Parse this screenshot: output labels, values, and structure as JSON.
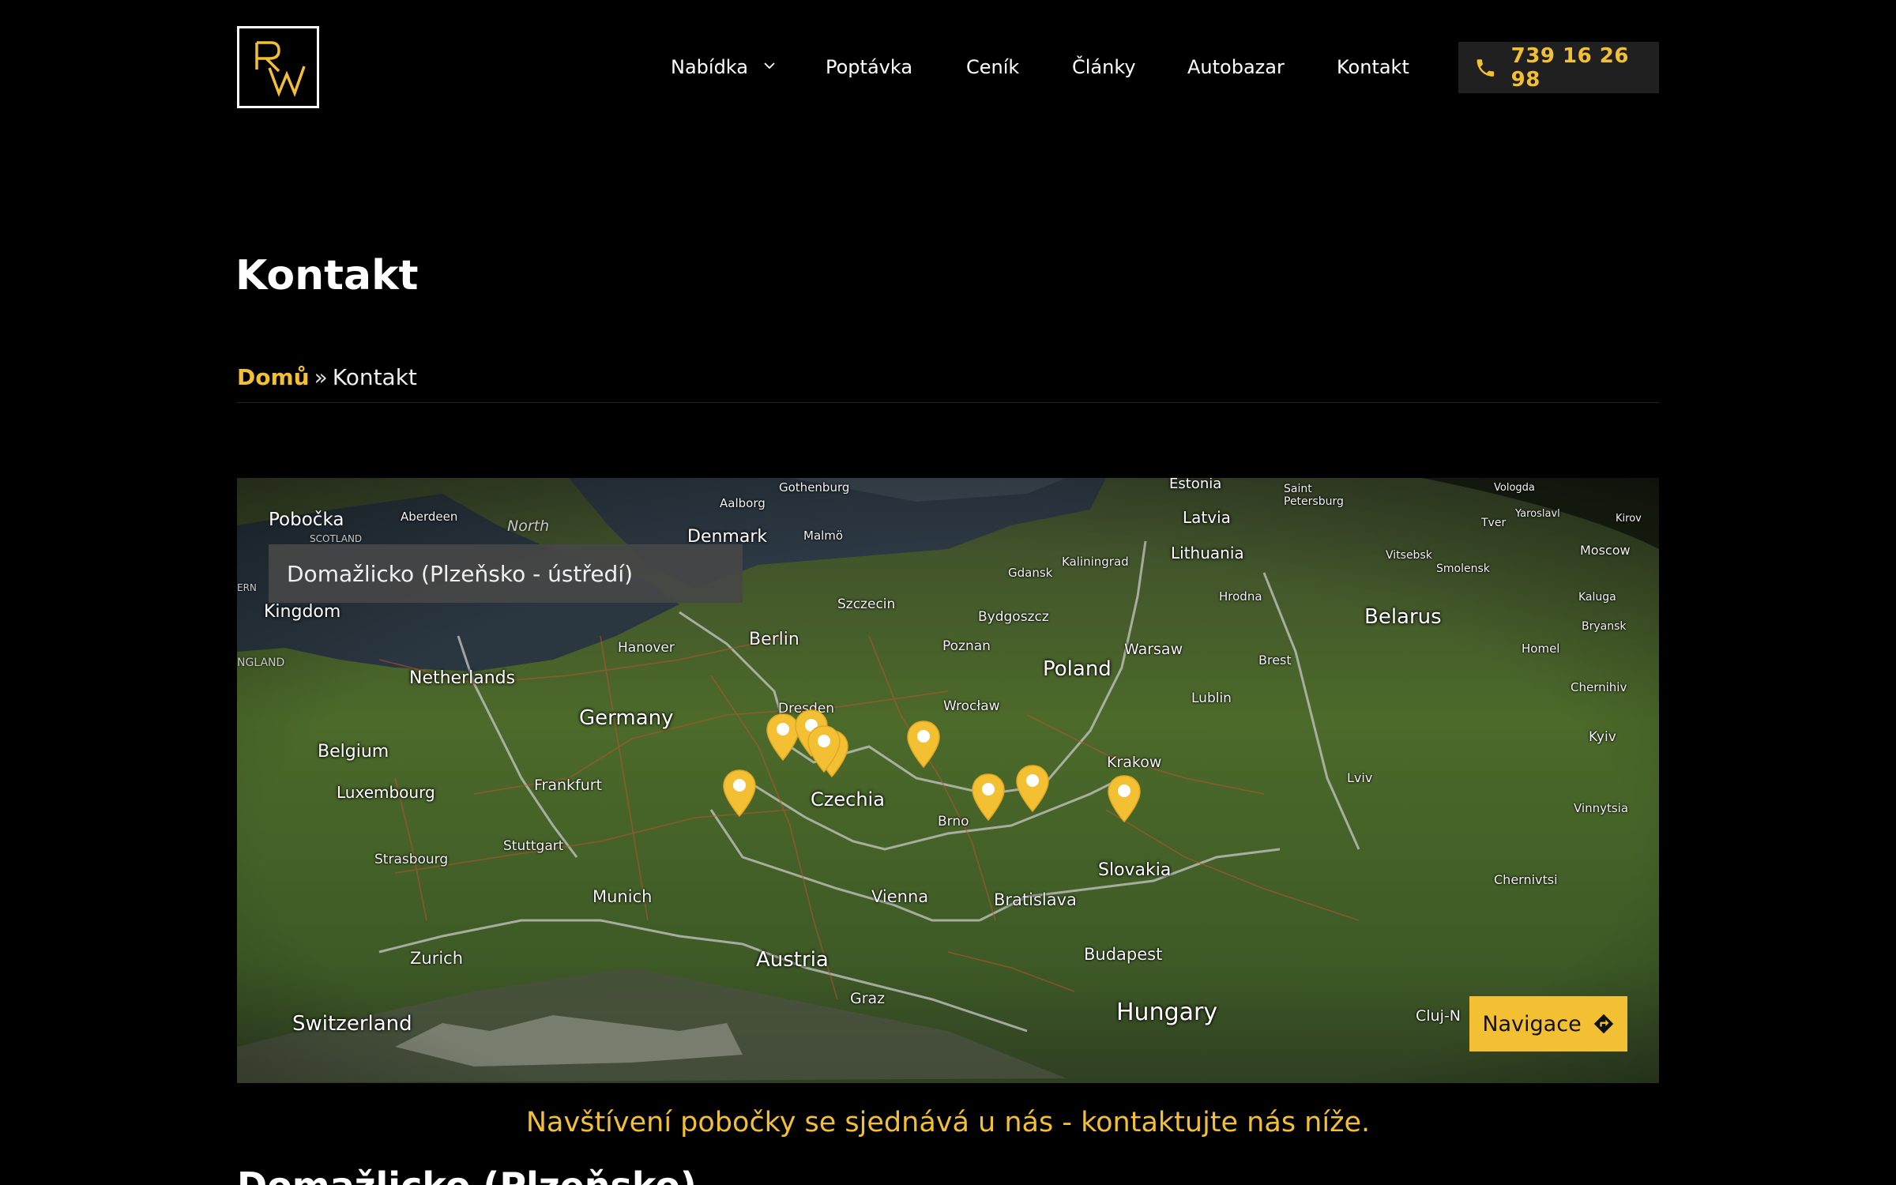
{
  "colors": {
    "accent": "#f3c034",
    "background": "#000000",
    "select_bg": "#464646"
  },
  "header": {
    "logo_icon": "rw-monogram-logo",
    "nav": [
      {
        "label": "Nabídka",
        "has_dropdown": true
      },
      {
        "label": "Poptávka"
      },
      {
        "label": "Ceník"
      },
      {
        "label": "Články"
      },
      {
        "label": "Autobazar"
      },
      {
        "label": "Kontakt"
      }
    ],
    "phone": {
      "icon": "phone-icon",
      "number": "739 16 26 98"
    }
  },
  "page": {
    "title": "Kontakt",
    "breadcrumb": {
      "home": "Domů",
      "separator": "»",
      "current": "Kontakt"
    }
  },
  "map": {
    "branch_label": "Pobočka",
    "branch_selected": "Domažlicko (Plzeňsko - ústředí)",
    "navigation_button": "Navigace",
    "navigation_icon": "directions-icon",
    "countries": [
      "Kingdom",
      "Netherlands",
      "Germany",
      "Belgium",
      "Luxembourg",
      "Poland",
      "Belarus",
      "Czechia",
      "Slovakia",
      "Austria",
      "Switzerland",
      "Hungary",
      "Denmark",
      "Latvia",
      "Lithuania",
      "Estonia"
    ],
    "cities": [
      "Aberdeen",
      "Aalborg",
      "Gothenburg",
      "Malmö",
      "Gdansk",
      "Kaliningrad",
      "Szczecin",
      "Bydgoszcz",
      "Berlin",
      "Hanover",
      "Poznan",
      "Warsaw",
      "Hrodna",
      "Brest",
      "Lublin",
      "Dresden",
      "Wrocław",
      "Frankfurt",
      "Krakow",
      "Lviv",
      "Brno",
      "Stuttgart",
      "Strasbourg",
      "Munich",
      "Vienna",
      "Bratislava",
      "Zurich",
      "Graz",
      "Budapest",
      "Kyiv",
      "Chernihiv",
      "Homel",
      "Vinnytsia",
      "Chernivtsi",
      "Moscow",
      "Smolensk",
      "Vitsebsk",
      "Tver",
      "Yaroslavl",
      "Vologda",
      "Kaluga",
      "Bryansk",
      "Saint Petersburg",
      "Kirov",
      "Cluj-N"
    ],
    "minor": [
      "North",
      "SCOTLAND",
      "NGLAND",
      "ERN"
    ],
    "pins": 9
  },
  "notice": "Navštívení pobočky se sjednává u nás - kontaktujte nás níže.",
  "next_heading": "Domažlicko (Plzeňsko)"
}
